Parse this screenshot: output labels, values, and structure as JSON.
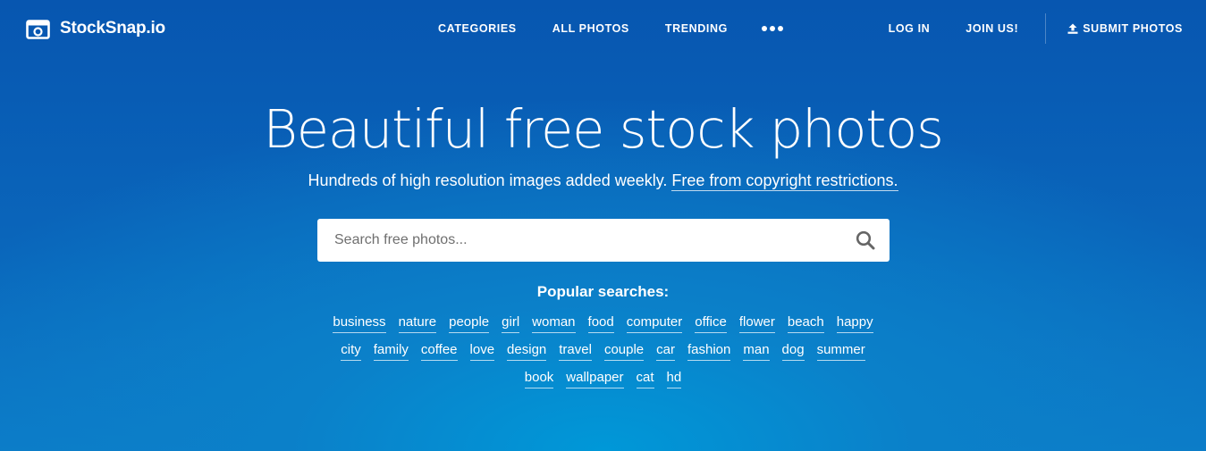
{
  "brand": {
    "name": "StockSnap.io",
    "icon": "camera-icon"
  },
  "nav": {
    "categories": "CATEGORIES",
    "all_photos": "ALL PHOTOS",
    "trending": "TRENDING",
    "more_icon": "more-dots-icon",
    "login": "LOG IN",
    "join": "JOIN US!",
    "submit": "SUBMIT PHOTOS",
    "submit_icon": "upload-icon"
  },
  "hero": {
    "title": "Beautiful free stock photos",
    "subtitle": "Hundreds of high resolution images added weekly.",
    "subtitle_link": "Free from copyright restrictions."
  },
  "search": {
    "placeholder": "Search free photos...",
    "value": "",
    "icon": "search-icon"
  },
  "popular": {
    "label": "Popular searches:",
    "rows": [
      [
        "business",
        "nature",
        "people",
        "girl",
        "woman",
        "food",
        "computer",
        "office",
        "flower",
        "beach",
        "happy"
      ],
      [
        "city",
        "family",
        "coffee",
        "love",
        "design",
        "travel",
        "couple",
        "car",
        "fashion",
        "man",
        "dog",
        "summer"
      ],
      [
        "book",
        "wallpaper",
        "cat",
        "hd"
      ]
    ]
  },
  "colors": {
    "background_top": "#0756b0",
    "background_glow": "#0098d8",
    "text": "#ffffff",
    "search_box": "#ffffff"
  }
}
